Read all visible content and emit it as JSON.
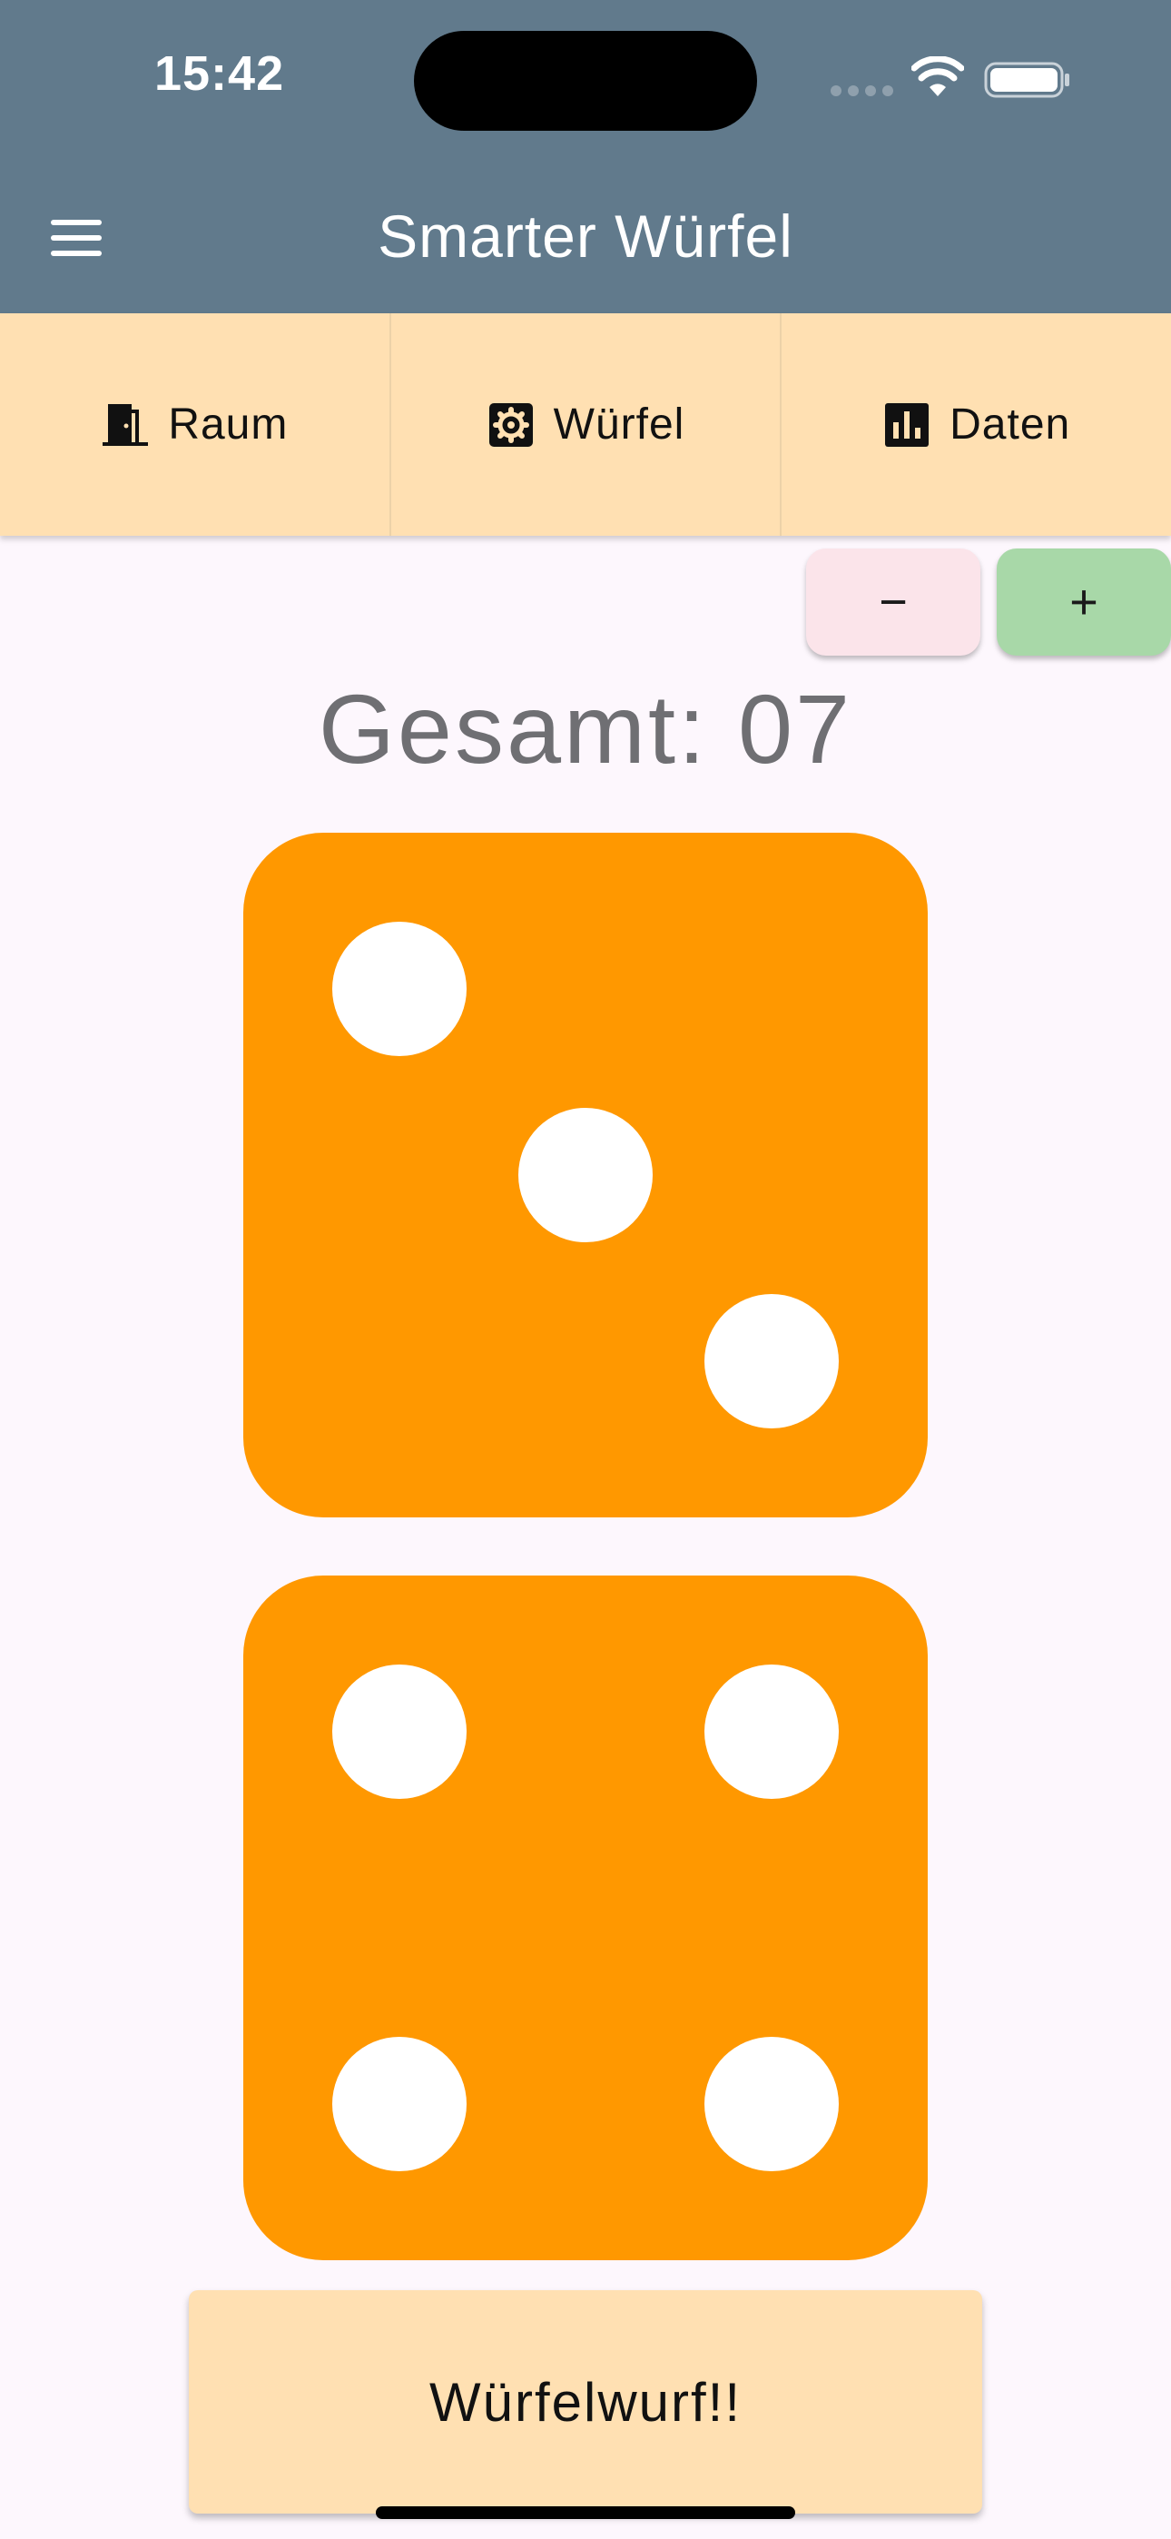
{
  "status_bar": {
    "time": "15:42",
    "icons": [
      "signal-dots-icon",
      "wifi-icon",
      "battery-icon"
    ]
  },
  "app_bar": {
    "title": "Smarter Würfel",
    "menu_icon": "menu-icon",
    "background_color": "#617a8c"
  },
  "tabs": [
    {
      "label": "Raum",
      "icon": "door-icon"
    },
    {
      "label": "Würfel",
      "icon": "gear-icon"
    },
    {
      "label": "Daten",
      "icon": "bar-chart-icon"
    }
  ],
  "stepper": {
    "minus_label": "−",
    "plus_label": "+"
  },
  "total": {
    "text": "Gesamt: 07",
    "value": 7
  },
  "dice": [
    {
      "value": 3,
      "color": "#ff9800"
    },
    {
      "value": 4,
      "color": "#ff9800"
    }
  ],
  "roll_button": {
    "label": "Würfelwurf!!"
  },
  "colors": {
    "accent": "#ffe0b2",
    "dice": "#ff9800",
    "plus": "#a8d8a8",
    "minus": "#fbe4ea"
  }
}
